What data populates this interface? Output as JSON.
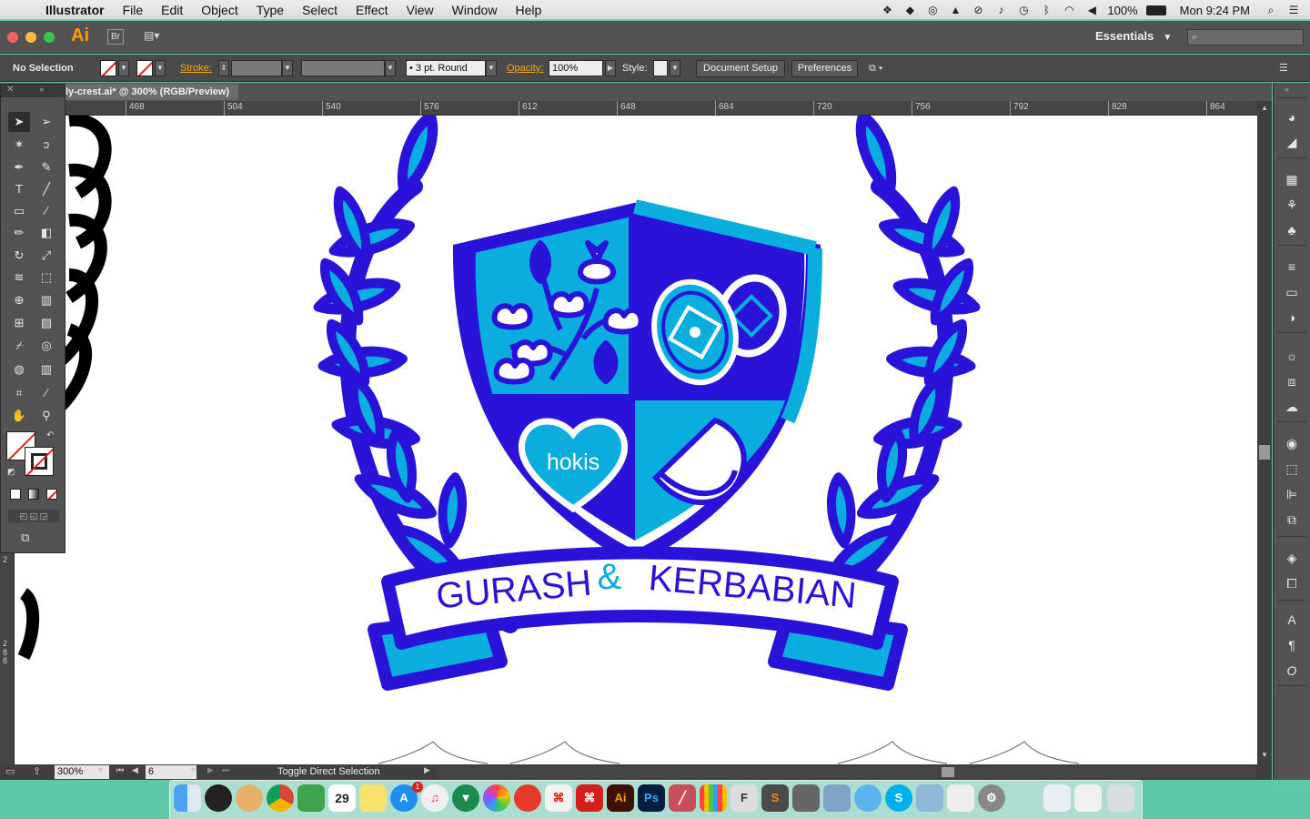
{
  "menubar": {
    "app_name": "Illustrator",
    "menus": [
      "File",
      "Edit",
      "Object",
      "Type",
      "Select",
      "Effect",
      "View",
      "Window",
      "Help"
    ],
    "battery": "100%",
    "clock": "Mon 9:24 PM"
  },
  "appbar": {
    "logo": "Ai",
    "bridge_label": "Br",
    "workspace": "Essentials"
  },
  "control": {
    "selection": "No Selection",
    "stroke_label": "Stroke:",
    "brush_profile": "3 pt. Round",
    "opacity_label": "Opacity:",
    "opacity_value": "100%",
    "style_label": "Style:",
    "doc_setup": "Document Setup",
    "preferences": "Preferences"
  },
  "document": {
    "tab_title": "ly-crest.ai* @ 300% (RGB/Preview)",
    "ruler_ticks": [
      "468",
      "504",
      "540",
      "576",
      "612",
      "648",
      "684",
      "720",
      "756",
      "792",
      "828",
      "864"
    ],
    "ruler_v_labels": [
      "2",
      "2",
      "8",
      "8"
    ]
  },
  "crest": {
    "heart_text": "hokis",
    "banner_left": "GURASH",
    "banner_amp": "&",
    "banner_right": "KERBABIAN",
    "colors": {
      "dark": "#2a13d8",
      "light": "#09aedf",
      "white": "#ffffff"
    }
  },
  "status": {
    "zoom": "300%",
    "page": "6",
    "hint": "Toggle Direct Selection"
  },
  "icons": {
    "tools": [
      "selection-icon",
      "direct-selection-icon",
      "magic-wand-icon",
      "lasso-icon",
      "pen-icon",
      "curvature-icon",
      "type-icon",
      "line-icon",
      "rectangle-icon",
      "paintbrush-icon",
      "pencil-icon",
      "eraser-icon",
      "rotate-icon",
      "scale-icon",
      "warp-icon",
      "free-transform-icon",
      "shape-builder-icon",
      "perspective-icon",
      "mesh-icon",
      "gradient-icon",
      "eyedropper-icon",
      "blend-icon",
      "symbol-sprayer-icon",
      "graph-icon",
      "artboard-icon",
      "slice-icon",
      "hand-icon",
      "zoom-icon"
    ],
    "dock_apps": [
      "finder",
      "launchpad",
      "photos",
      "chrome",
      "evernote",
      "calendar",
      "stickies",
      "app-store",
      "itunes",
      "vectorize",
      "photos-colors",
      "tomato",
      "acrobat",
      "acrobat-reader",
      "illustrator",
      "photoshop",
      "clip",
      "palette",
      "fontexplorer",
      "sublime",
      "preview",
      "image-capture",
      "messages",
      "skype",
      "mail",
      "wunderlist",
      "system-preferences",
      "downloads",
      "trash"
    ]
  },
  "calendar_day": "29",
  "dock_badge": "1"
}
